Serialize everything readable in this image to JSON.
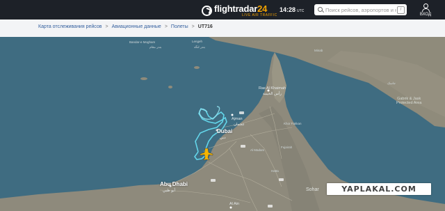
{
  "header": {
    "logo_name_a": "flightradar",
    "logo_name_b": "24",
    "logo_tagline": "LIVE AIR TRAFFIC",
    "time": "14:28",
    "timezone": "UTC",
    "search_placeholder": "Поиск рейсов, аэропортов и н",
    "search_shortcut": "/",
    "login_label": "ВХОД"
  },
  "breadcrumb": {
    "items": [
      "Карта отслеживания рейсов",
      "Авиационные данные",
      "Полеты"
    ],
    "separator": ">",
    "current": "UT716"
  },
  "map": {
    "labels": {
      "iran_city_1": "Bandar-e Mogham",
      "iran_city_1_ar": "بندر مقام",
      "iran_city_2": "Lengeh",
      "iran_city_2_ar": "بندر لنگه",
      "jask_region": "Gabrik & Jask\nProtected Area",
      "minab": "Minab",
      "jashk": "جاسک",
      "ras_al_khaimah": "Ras Al Khaimah",
      "ras_al_khaimah_ar": "رأس الخيمة",
      "ajman": "Ajman",
      "ajman_ar": "عجمان",
      "dubai": "Dubai",
      "dubai_ar": "دبي",
      "abu_dhabi": "Abu Dhabi",
      "abu_dhabi_ar": "أبو ظبي",
      "al_ain": "Al Ain",
      "sohar": "Sohar",
      "khor_fakkan": "Khor Fakkan",
      "fujairah": "Fujairah",
      "al_madam": "Al Madam",
      "hatta": "Hatta"
    }
  },
  "watermark": {
    "text": "YAPLAKAL.COM"
  },
  "colors": {
    "header_bg": "#1d2128",
    "accent": "#f4a300",
    "sea": "#3f6c81",
    "land": "#8e8a7c",
    "track": "#5fd3e6",
    "link": "#34609e"
  }
}
